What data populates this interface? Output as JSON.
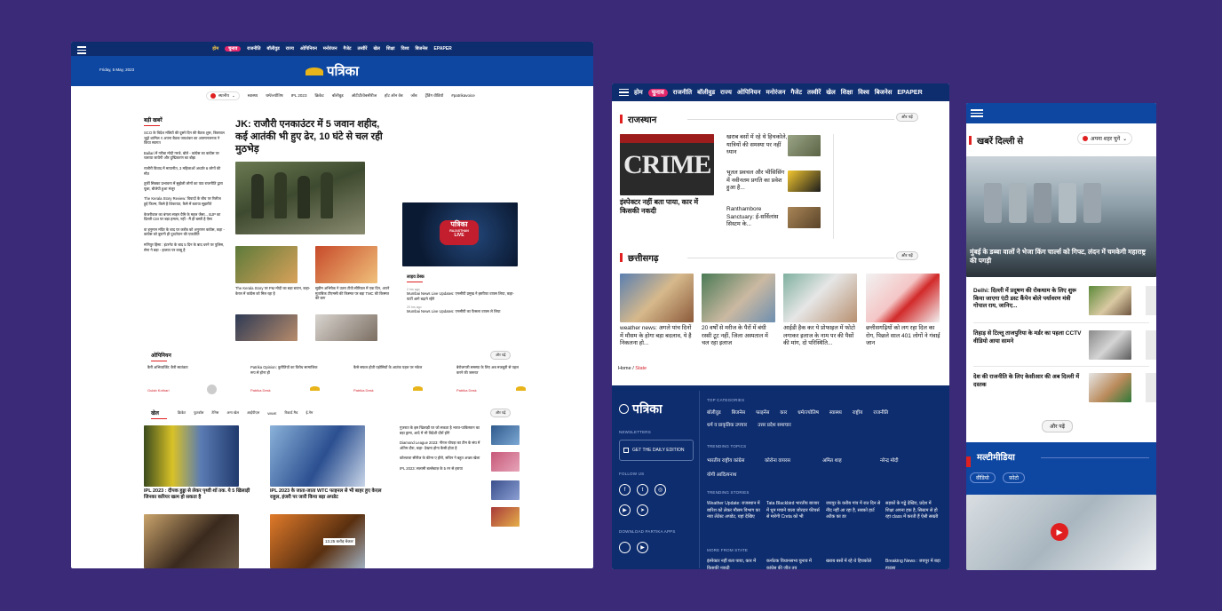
{
  "desktop": {
    "nav": [
      "होम",
      "चुनाव",
      "राजनीति",
      "बॉलीवुड",
      "राज्य",
      "ओपिनियन",
      "मनोरंजन",
      "गैजेट",
      "तस्वीरें",
      "खेल",
      "शिक्षा",
      "विश्व",
      "बिजनेस",
      "EPAPER"
    ],
    "date": "Friday, 5 May, 2023",
    "logo": "पत्रिका",
    "city": "स्थानीय",
    "subnav": [
      "स्वास्थ्य",
      "धर्म/ज्योतिष",
      "IPL 2023",
      "क्रिकेट",
      "बॉलीवुड",
      "ओटीटी/वेबसीरीज",
      "हॉट ऑन वेब",
      "जॉब",
      "ट्रेंडिंग वीडियो",
      "#patrikavoice"
    ],
    "top_news_title": "बड़ी खबरें",
    "top_news": [
      "SCO के विदेश मंत्रियों की दूसरे दिन की बैठक शुरू, बिलावल भुट्टो शामिल !! अपना बैठक जयशंकर का अपमानजनक ने किया स्वागत",
      "Ballari में गरीबा मोदी गरजे, बोले - कांग्रेस का कांग्रेस पर चलाया जायेगी और दुष्प्रिकरण का बोझ",
      "राजौरी विवाद में मायानीत, 3 महिलाओं अर्ध्यार 6 लोगों की मौत",
      "तुर्की सिक्का प्रभावना में सुझेली लोगों का पाठ राजनीति द्वारा पूछा, बीजेपी हुआ मंजूर",
      "The Kerala Story Review: विवादों के बीच पर रिलीज हुई फिल्म, किसे है शिकायत, कैसे में बताया सुझरीते",
      "केजरीवाल का बंगला साइन ग्रैमि के महल जैसा... BJP का दिल्ली CM पर बड़ा हमला, नहीं - मैं ही बस्ती है ऐसा",
      "वा हनुमान मंदिर के बाद पर करोंब को अनुरागर कांग्रेस, कहा - कांग्रेस को बुरानी ही दुर्ध्यापान की एकतीति",
      "मणिपुर हिंसा : इंटरनेट के बाद 5 दिन के बाद धरने पर पुलिस, सेना ने बड़ा - हालात पर काबू है"
    ],
    "headline": "JK: राजौरी एनकाउंटर में 5 जवान शहीद, कई आतंकी भी हुए ढेर, 10 घंटे से चल रही मुठभेड़",
    "sub_stories": [
      "The Kerala Story पर PM मोदी का बड़ा बयान, कहा- केरल में कांग्रेस को मिल रहा है",
      "सुप्रीम अभिषेक ने उतरा टीवी सीरियल में एक दिन, अपने मुताबिक टीएमसी की किस्मत पर बड़ा TMC की किस्मत की बाग"
    ],
    "live_badge": "पत्रिका",
    "live_sub": "RAJASTHAN",
    "live_text": "LIVE",
    "live_desk_title": "लाइव डेस्क",
    "live_items": [
      {
        "time": "2 hrs ago",
        "text": "Mumbai News Live Updates: एनसीपी प्रमुख ने इस्तीफा वापस लिया, कहा- पार्टी आगे बढ़ाने रहेंगे"
      },
      {
        "time": "20 hrs ago",
        "text": "Mumbai News Live Updates: एनसीपी का फैसला वापस ले लिया"
      }
    ],
    "opinion_title": "ओपिनियन",
    "more": "और पढ़ें",
    "opinions": [
      {
        "text": "कैरी अभिव्यक्ति: कैरी स्वतंत्रता",
        "author": "Gulab Kothari"
      },
      {
        "text": "Patrika Opinion: कुरीतियों का विरोध सामाजिक रूप से होना ही",
        "author": "Patrika Desk"
      },
      {
        "text": "कैसे सफल होती पड़ोसियों के आतंक पहल पर नकेल",
        "author": "Patrika Desk"
      },
      {
        "text": "बेरोजगारी समस्या के लिए अब मजबूती से पहल करने की जरूरत",
        "author": "Patrika Desk"
      }
    ],
    "sports_title": "खेल",
    "sports_tabs": [
      "क्रिकेट",
      "फुटबॉल",
      "टेनिस",
      "अन्य खेल",
      "आईपीएल",
      "WWE",
      "रिकार्ड मैच",
      "ई-गेम"
    ],
    "sports_main": [
      "IPL 2023 : दीपक हुड्डा से लेकर पृथ्वी शॉ तक. ये 5 खिलाड़ी जिनका करियर खत्म हो सकता है",
      "IPL 2023 के जाता-जाता WTC फाइनल से भी बाहर हुए केएल राहुल, इंजरी पर जारी किया बड़ा अपडेट"
    ],
    "sports_side": [
      "गुजरात के इस खिलाड़ी पर जो सकता है भारत-पाकिस्तान का बड़ा ड्रामा, आदे में भी विदेशी दौरों होंगे",
      "Diamond League 2023: नीरज चोपड़ा का टीम के संघ में अंतिम दौरा, कहा- देखना होगा कैसी होता है",
      "कोल्कत्ता सीरीज के कीनर ए हीरो, सचिन ने बहुत अच्छा खेला",
      "IPL 2023: सलामी बल्लेबाज़ के 5 रन से हराया"
    ],
    "score_label": "13.25 करोड़ बेकार"
  },
  "tablet": {
    "nav": [
      "होम",
      "चुनाव",
      "राजनीति",
      "बॉलीवुड",
      "राज्य",
      "ओपिनियन",
      "मनोरंजन",
      "गैजेट",
      "तस्वीरें",
      "खेल",
      "शिक्षा",
      "विश्व",
      "बिजनेस",
      "EPAPER"
    ],
    "rajasthan_title": "राजस्थान",
    "more": "और पढ़ें",
    "crime_word": "CRIME",
    "crime_caption": "इंस्पेक्टर नहीं बता पाया, कार में किसकी नकदी",
    "raj_items": [
      "खराब बसों में रहे थे हिचकोले, यात्रियों की समस्या पर नहीं ध्यान",
      "भूतल प्रवचल और भीसिसिंग में नवीनतम प्रगति का प्रवेश हुआ है...",
      "Ranthambore Sanctuary: ई-सर्विलांस सिस्टम के..."
    ],
    "cg_title": "छत्तीसगढ़",
    "cg_items": [
      "weather news: अगले पांच दिनों में मौसम के होगा बड़ा बदलाव, ये है निकलना हो...",
      "20 वर्षों से मरीज के पैरों में बंधी रस्सी टूट नहीं, जिला अस्पताल में चल रहा इलाज",
      "आईडी हैक कर ये प्रोफाइल में फोटो लगाकर इलाज के नाम पर की पैसों की मांग, दो परिस्थिति...",
      "छत्तीसगढ़ियों को लग रहा दिल का रोग, पिछले साल 401 लोगों ने गंवाई जान"
    ],
    "breadcrumb_home": "Home",
    "breadcrumb_sep": "/",
    "breadcrumb_current": "State",
    "footer": {
      "logo": "पत्रिका",
      "newsletters": "NEWSLETTERS",
      "edition_btn": "GET THE DAILY EDITION",
      "follow": "FOLLOW US",
      "download": "DOWNLOAD PARTIKA APPS",
      "top_cat": "TOP CATEGORIES",
      "cats": [
        "बॉलीवुड",
        "बिजनेस",
        "फाइनेंस",
        "कार",
        "धर्म/ज्योतिष",
        "स्वास्थ्य",
        "राष्ट्रीय",
        "राजनीति",
        "धर्म व प्राकृतिक उपचार",
        "उत्तर प्रदेश समाचार"
      ],
      "trending_topics": "TRENDING TOPICS",
      "topics": [
        "भारतीय राष्ट्रीय कांग्रेस",
        "कोरोना वायरस",
        "अमित शाह",
        "नरेन्द्र मोदी",
        "योगी आदित्यनाथ"
      ],
      "trending_stories": "TRENDING STORIES",
      "stories": [
        "Weather Update: राजस्थान में बारिश को लेकर मौसम विभाग का नया लेटेस्ट अपडेट, यहां देखिए",
        "Tata Blackbird भारतीय बाजार में धूम मचाने वाला जोरदार फीचर्स से मारेगी Creta को भी",
        "जयपुर के करीब गांव में रात दिन से नींद नहीं आ रहा है, सबको हार्ट अटैक का डर",
        "सड़कों के गड्ढे देखिए, प्रदेश में शिक्षा अपना हक है, सिस्टम से हो रहा class में करती हैं ऐसी सख्ती"
      ],
      "more_state": "MORE FROM STATE",
      "state_items": [
        "इंस्पेक्टर नहीं बता पाया, कार में किसकी नकदी",
        "कर्नाटक विधानसभा चुनाव में कांग्रेस की जीत तय",
        "खराब बसों में रहे थे हिचकोले",
        "Breaking News : जयपुर में बड़ा हादसा"
      ]
    }
  },
  "mobile": {
    "title": "खबरें दिल्ली से",
    "city_select": "अपना शहर चुनें",
    "hero_caption": "मुंबई के डब्बा वालों ने भेजा किंग चार्ल्स को गिफ्ट, लंदन में चमकेगी महाराष्ट्र की पगड़ी",
    "items": [
      "Delhi: दिल्ली में प्रदूषण की रोकथाम के लिए शुरू किया जाएगा एंटी डस्ट कैंपेन बोले पर्यावरण मंत्री गोपाल राय, जानिए...",
      "तिहाड़ से टिल्लू ताजपुरिया के मर्डर का पहला CCTV वीडियो आया सामने",
      "देश की राजनीति के लिए केसीआर की अब दिल्ली में दस्तक"
    ],
    "more": "और पढ़ें",
    "multimedia_title": "मल्टीमीडिया",
    "tabs": [
      "वीडियो",
      "फ़ोटो"
    ]
  },
  "colors": {
    "navy": "#0e2d6e",
    "blue": "#0e47a1",
    "accent": "#e02020",
    "pink": "#e2266b",
    "bg": "#3b2a78"
  }
}
